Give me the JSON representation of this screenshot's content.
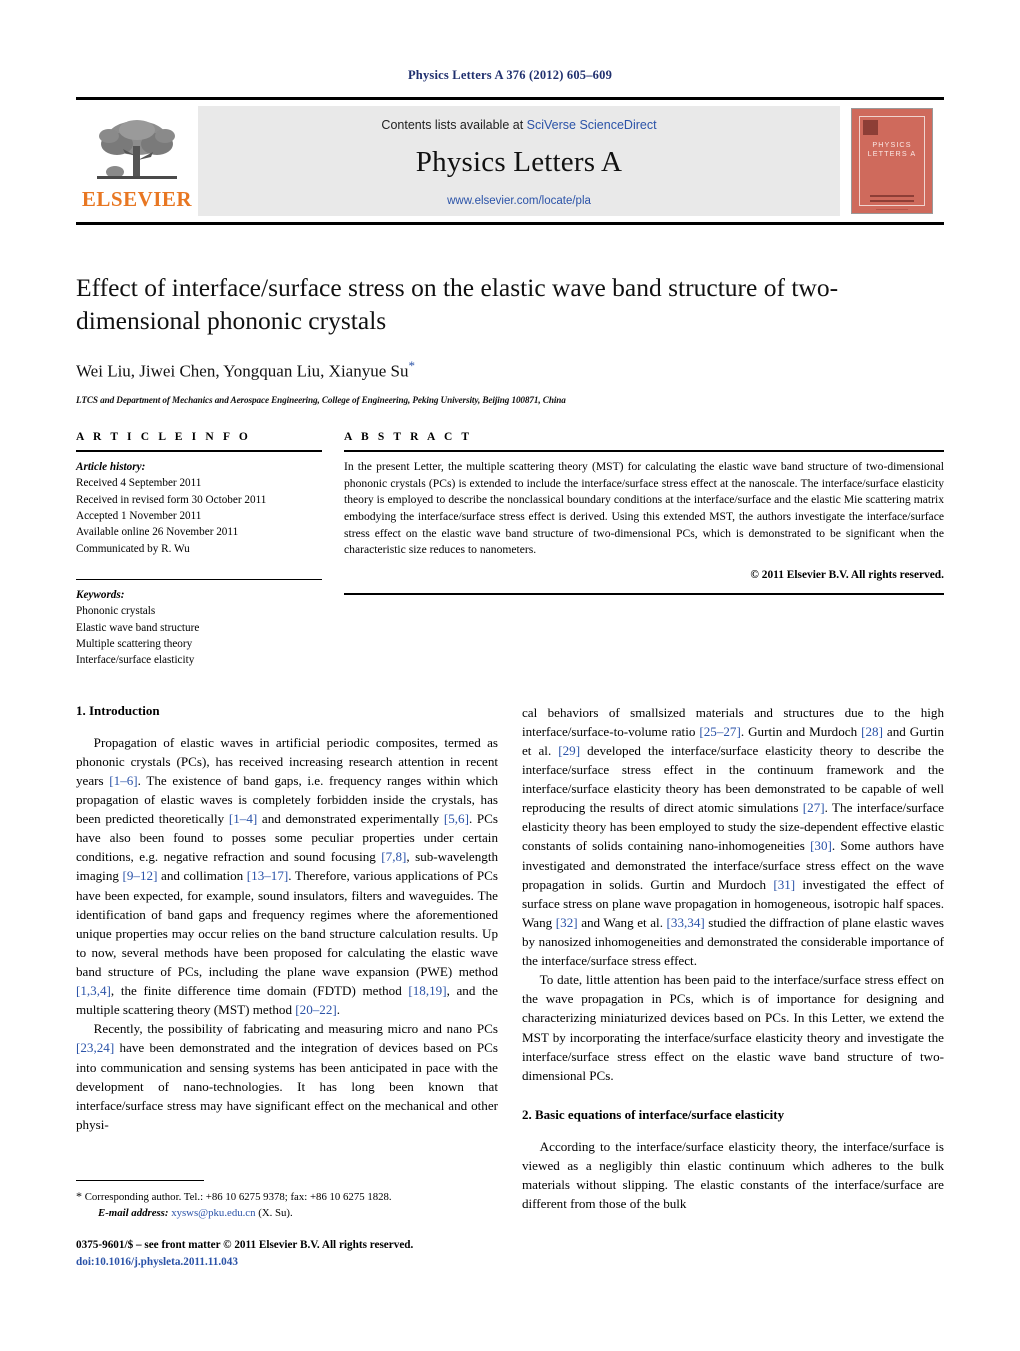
{
  "running_head": "Physics Letters A 376 (2012) 605–609",
  "masthead": {
    "publisher_logo_text": "ELSEVIER",
    "contents_prefix": "Contents lists available at ",
    "contents_link": "SciVerse ScienceDirect",
    "journal_name": "Physics Letters A",
    "journal_url": "www.elsevier.com/locate/pla",
    "cover_title": "PHYSICS LETTERS A"
  },
  "article": {
    "title": "Effect of interface/surface stress on the elastic wave band structure of two-dimensional phononic crystals",
    "authors": "Wei Liu, Jiwei Chen, Yongquan Liu, Xianyue Su",
    "corresponding_marker": "*",
    "affiliation": "LTCS and Department of Mechanics and Aerospace Engineering, College of Engineering, Peking University, Beijing 100871, China"
  },
  "info": {
    "heading": "A R T I C L E    I N F O",
    "history_label": "Article history:",
    "history": [
      "Received 4 September 2011",
      "Received in revised form 30 October 2011",
      "Accepted 1 November 2011",
      "Available online 26 November 2011",
      "Communicated by R. Wu"
    ],
    "keywords_label": "Keywords:",
    "keywords": [
      "Phononic crystals",
      "Elastic wave band structure",
      "Multiple scattering theory",
      "Interface/surface elasticity"
    ]
  },
  "abstract": {
    "heading": "A B S T R A C T",
    "text": "In the present Letter, the multiple scattering theory (MST) for calculating the elastic wave band structure of two-dimensional phononic crystals (PCs) is extended to include the interface/surface stress effect at the nanoscale. The interface/surface elasticity theory is employed to describe the nonclassical boundary conditions at the interface/surface and the elastic Mie scattering matrix embodying the interface/surface stress effect is derived. Using this extended MST, the authors investigate the interface/surface stress effect on the elastic wave band structure of two-dimensional PCs, which is demonstrated to be significant when the characteristic size reduces to nanometers.",
    "copyright": "© 2011 Elsevier B.V. All rights reserved."
  },
  "sections": {
    "intro_heading": "1. Introduction",
    "sec2_heading": "2. Basic equations of interface/surface elasticity"
  },
  "body": {
    "left": {
      "p1_a": "Propagation of elastic waves in artificial periodic composites, termed as phononic crystals (PCs), has received increasing research attention in recent years ",
      "p1_r1": "[1–6]",
      "p1_b": ". The existence of band gaps, i.e. frequency ranges within which propagation of elastic waves is completely forbidden inside the crystals, has been predicted theoretically ",
      "p1_r2": "[1–4]",
      "p1_c": " and demonstrated experimentally ",
      "p1_r3": "[5,6]",
      "p1_d": ". PCs have also been found to posses some peculiar properties under certain conditions, e.g. negative refraction and sound focusing ",
      "p1_r4": "[7,8]",
      "p1_e": ", sub-wavelength imaging ",
      "p1_r5": "[9–12]",
      "p1_f": " and collimation ",
      "p1_r6": "[13–17]",
      "p1_g": ". Therefore, various applications of PCs have been expected, for example, sound insulators, filters and waveguides. The identification of band gaps and frequency regimes where the aforementioned unique properties may occur relies on the band structure calculation results. Up to now, several methods have been proposed for calculating the elastic wave band structure of PCs, including the plane wave expansion (PWE) method ",
      "p1_r7": "[1,3,4]",
      "p1_h": ", the finite difference time domain (FDTD) method ",
      "p1_r8": "[18,19]",
      "p1_i": ", and the multiple scattering theory (MST) method ",
      "p1_r9": "[20–22]",
      "p1_j": ".",
      "p2_a": "Recently, the possibility of fabricating and measuring micro and nano PCs ",
      "p2_r1": "[23,24]",
      "p2_b": " have been demonstrated and the integration of devices based on PCs into communication and sensing systems has been anticipated in pace with the development of nano-technologies. It has long been known that interface/surface stress may have significant effect on the mechanical and other physi-"
    },
    "right": {
      "p2_c": "cal behaviors of smallsized materials and structures due to the high interface/surface-to-volume ratio ",
      "p2_r2": "[25–27]",
      "p2_d": ". Gurtin and Murdoch ",
      "p2_r3": "[28]",
      "p2_e": " and Gurtin et al. ",
      "p2_r4": "[29]",
      "p2_f": " developed the interface/surface elasticity theory to describe the interface/surface stress effect in the continuum framework and the interface/surface elasticity theory has been demonstrated to be capable of well reproducing the results of direct atomic simulations ",
      "p2_r5": "[27]",
      "p2_g": ". The interface/surface elasticity theory has been employed to study the size-dependent effective elastic constants of solids containing nano-inhomogeneities ",
      "p2_r6": "[30]",
      "p2_h": ". Some authors have investigated and demonstrated the interface/surface stress effect on the wave propagation in solids. Gurtin and Murdoch ",
      "p2_r7": "[31]",
      "p2_i": " investigated the effect of surface stress on plane wave propagation in homogeneous, isotropic half spaces. Wang ",
      "p2_r8": "[32]",
      "p2_j": " and Wang et al. ",
      "p2_r9": "[33,34]",
      "p2_k": " studied the diffraction of plane elastic waves by nanosized inhomogeneities and demonstrated the considerable importance of the interface/surface stress effect.",
      "p3": "To date, little attention has been paid to the interface/surface stress effect on the wave propagation in PCs, which is of importance for designing and characterizing miniaturized devices based on PCs. In this Letter, we extend the MST by incorporating the interface/surface elasticity theory and investigate the interface/surface stress effect on the elastic wave band structure of two-dimensional PCs.",
      "p4": "According to the interface/surface elasticity theory, the interface/surface is viewed as a negligibly thin elastic continuum which adheres to the bulk materials without slipping. The elastic constants of the interface/surface are different from those of the bulk"
    }
  },
  "footnotes": {
    "corresponding_marker": "*",
    "corresponding": "Corresponding author. Tel.: +86 10 6275 9378; fax: +86 10 6275 1828.",
    "email_label": "E-mail address:",
    "email": "xysws@pku.edu.cn",
    "email_owner": "(X. Su).",
    "issn_line": "0375-9601/$ – see front matter  © 2011 Elsevier B.V. All rights reserved.",
    "doi": "doi:10.1016/j.physleta.2011.11.043"
  }
}
